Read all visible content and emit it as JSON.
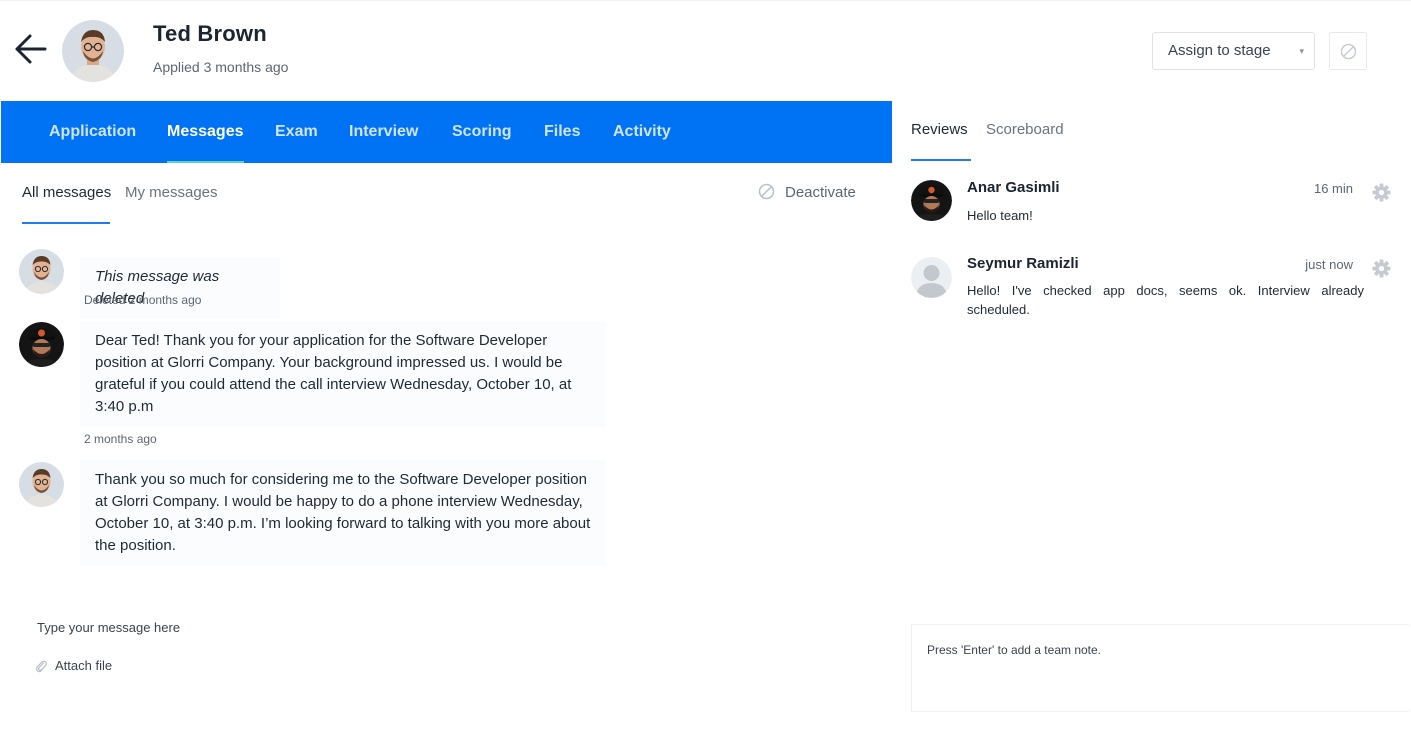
{
  "candidate": {
    "name": "Ted Brown",
    "applied": "Applied 3 months ago"
  },
  "header": {
    "assign_label": "Assign to stage",
    "assign_caret": "▾"
  },
  "tabs": [
    {
      "label": "Application"
    },
    {
      "label": "Messages"
    },
    {
      "label": "Exam"
    },
    {
      "label": "Interview"
    },
    {
      "label": "Scoring"
    },
    {
      "label": "Files"
    },
    {
      "label": "Activity"
    }
  ],
  "active_tab": "Messages",
  "subtabs": {
    "all": "All messages",
    "mine": "My messages",
    "deactivate": "Deactivate"
  },
  "messages": [
    {
      "text": "This message was deleted",
      "meta": "Deleted 2 months ago",
      "deleted": true
    },
    {
      "text": "Dear Ted! Thank you for your application for the Software Developer position at Glorri Company. Your background impressed us. I would be grateful if you could attend the call interview Wednesday, October 10, at 3:40 p.m",
      "meta": "2 months ago"
    },
    {
      "text": "Thank you so much for considering me to the Software Developer position at Glorri Company. I would be happy to do a phone interview Wednesday, October 10, at 3:40 p.m. I’m looking forward to talking with you more about the position."
    }
  ],
  "composer": {
    "placeholder": "Type your message here",
    "attach": "Attach file"
  },
  "right_tabs": {
    "reviews": "Reviews",
    "scoreboard": "Scoreboard"
  },
  "reviews": [
    {
      "name": "Anar Gasimli",
      "time": "16 min",
      "text": "Hello team!"
    },
    {
      "name": "Seymur Ramizli",
      "time": "just now",
      "text": "Hello! I've checked app docs, seems ok. Interview already scheduled."
    }
  ],
  "note": {
    "placeholder": "Press 'Enter' to add a team note."
  },
  "colors": {
    "tab_bar": "#0073f5",
    "accent": "#1e7cf0",
    "active_tab_underline": "#5dd4c2"
  }
}
